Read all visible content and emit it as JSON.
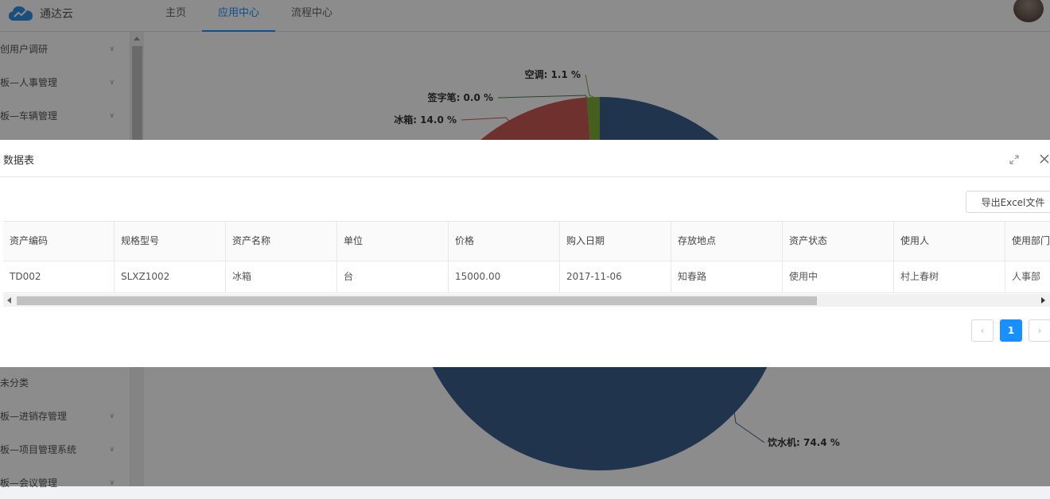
{
  "app": {
    "title": "通达云"
  },
  "topnav": {
    "items": [
      {
        "label": "主页"
      },
      {
        "label": "应用中心"
      },
      {
        "label": "流程中心"
      }
    ],
    "active": 1
  },
  "sidebar": {
    "items": [
      {
        "label": "创用户调研"
      },
      {
        "label": "板—人事管理"
      },
      {
        "label": "板—车辆管理"
      },
      {
        "label": "未分类"
      },
      {
        "label": "板—进销存管理"
      },
      {
        "label": "板—项目管理系统"
      },
      {
        "label": "板—会议管理"
      }
    ]
  },
  "chart_data": {
    "type": "pie",
    "categories": [
      "饮水机",
      "冰箱",
      "签字笔",
      "空调"
    ],
    "values": [
      74.4,
      14.0,
      0.0,
      1.1
    ],
    "labels": [
      "饮水机: 74.4 %",
      "冰箱: 14.0 %",
      "签字笔: 0.0 %",
      "空调: 1.1 %"
    ],
    "colors": [
      "#3b5f8f",
      "#c95a55",
      "#4a7a5a",
      "#7fae3a"
    ]
  },
  "modal": {
    "title": "数据表",
    "export_label": "导出Excel文件",
    "columns": [
      "资产编码",
      "规格型号",
      "资产名称",
      "单位",
      "价格",
      "购入日期",
      "存放地点",
      "资产状态",
      "使用人",
      "使用部门"
    ],
    "rows": [
      [
        "TD002",
        "SLXZ1002",
        "冰箱",
        "台",
        "15000.00",
        "2017-11-06",
        "知春路",
        "使用中",
        "村上春树",
        "人事部"
      ]
    ],
    "pagination": {
      "prev": "‹",
      "current": "1",
      "next": "›"
    }
  },
  "colors": {
    "accent": "#1890ff",
    "mask": "rgba(0,0,0,0.45)"
  }
}
